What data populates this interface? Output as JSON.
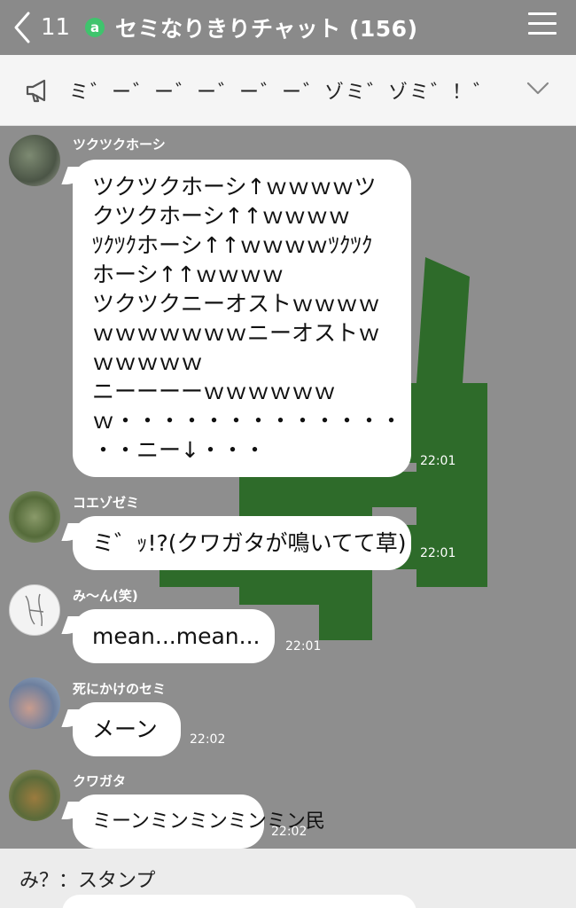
{
  "header": {
    "back_count": "11",
    "badge_letter": "a",
    "title": "セミなりきりチャット (156)"
  },
  "announcement": {
    "text": "ミ゛ー゛ー゛ー゛ー゛ー゛ゾミ゛ゾミ゛！゛"
  },
  "messages": [
    {
      "sender": "ツクツクホーシ",
      "lines": [
        "ツクツクホーシ↑ｗｗｗｗツ",
        "クツクホーシ↑↑ｗｗｗｗ",
        "ﾂｸﾂｸホーシ↑↑ｗｗｗｗﾂｸﾂｸ",
        "ホーシ↑↑ｗｗｗｗ",
        "ツクツクニーオストｗｗｗｗ",
        "ｗｗｗｗｗｗｗニーオストｗ",
        "ｗｗｗｗｗ",
        "ニーーーーｗｗｗｗｗｗ",
        "ｗ・・・・・・・・・・・・・",
        "・・ニー↓・・・"
      ],
      "time": "22:01"
    },
    {
      "sender": "コエゾゼミ",
      "lines": [
        "ミ゛ｯ!?(クワガタが鳴いてて草)"
      ],
      "time": "22:01"
    },
    {
      "sender": "み〜ん(笑)",
      "lines": [
        "mean...mean..."
      ],
      "time": "22:01"
    },
    {
      "sender": "死にかけのセミ",
      "lines": [
        "メーン"
      ],
      "time": "22:02"
    },
    {
      "sender": "クワガタ",
      "lines": [
        "ミーンミンミンミンミン民"
      ],
      "time": "22:02"
    }
  ],
  "bottom": {
    "text": "み？：スタンプ"
  },
  "colors": {
    "header_bg": "#8a8a8a",
    "chat_bg": "#8e8e8e",
    "art_green": "#2e6b2a",
    "badge_green": "#3fc46d"
  }
}
